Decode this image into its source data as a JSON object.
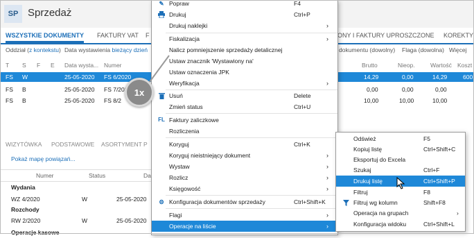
{
  "app": {
    "logo": "SP",
    "title": "Sprzedaż"
  },
  "tabs": [
    {
      "label": "WSZYSTKIE DOKUMENTY"
    },
    {
      "label": "FAKTURY VAT"
    },
    {
      "label": "F"
    },
    {
      "label": "ONY I FAKTURY UPROSZCZONE"
    },
    {
      "label": "KOREKTY"
    }
  ],
  "filters": {
    "branch_prefix": "Oddział (",
    "branch_link": "z kontekstu",
    "branch_suffix": ")",
    "date_prefix": "Data wystawienia",
    "date_link": "bieżący dzień",
    "doc_number": "dokumentu (dowolny)",
    "flag": "Flaga (dowolna)",
    "more": "Więcej"
  },
  "grid": {
    "headers": [
      "T",
      "S",
      "F",
      "E",
      "Data wysta...",
      "Numer",
      "Brutto",
      "Nieop.",
      "Wartość",
      "Koszt"
    ],
    "rows": [
      {
        "t": "FS",
        "s": "W",
        "date": "25-05-2020",
        "num": "FS 6/2020",
        "brutto": "14,29",
        "nieop": "0,00",
        "wartosc": "14,29",
        "koszt": "600",
        "selected": true
      },
      {
        "t": "FS",
        "s": "B",
        "date": "25-05-2020",
        "num": "FS 7/202",
        "brutto": "0,00",
        "nieop": "0,00",
        "wartosc": "0,00",
        "koszt": "",
        "selected": false
      },
      {
        "t": "FS",
        "s": "B",
        "date": "25-05-2020",
        "num": "FS 8/2",
        "brutto": "10,00",
        "nieop": "10,00",
        "wartosc": "10,00",
        "koszt": "",
        "selected": false
      }
    ]
  },
  "lower": {
    "tabs": [
      "WIZYTÓWKA",
      "PODSTAWOWE",
      "ASORTYMENT",
      "P"
    ],
    "show_map": "Pokaż mapę powiązań...",
    "headers": [
      "Numer",
      "Status",
      "Da"
    ],
    "groups": [
      {
        "name": "Wydania",
        "rows": [
          {
            "num": "WZ 4/2020",
            "status": "W",
            "date": "25-05-2020"
          }
        ]
      },
      {
        "name": "Rozchody",
        "rows": [
          {
            "num": "RW 2/2020",
            "status": "W",
            "date": "25-05-2020"
          }
        ]
      },
      {
        "name": "Operacje kasowe",
        "rows": []
      }
    ]
  },
  "menu": {
    "items": [
      {
        "label": "Popraw",
        "shortcut": "F4",
        "icon": "edit-icon"
      },
      {
        "label": "Drukuj",
        "shortcut": "Ctrl+P",
        "icon": "printer-icon"
      },
      {
        "label": "Drukuj naklejki",
        "submenu": true
      },
      {
        "label": "Fiskalizacja",
        "submenu": true
      },
      {
        "label": "Nalicz pomniejszenie sprzedaży detalicznej"
      },
      {
        "label": "Ustaw znacznik 'Wystawiony na'"
      },
      {
        "label": "Ustaw oznaczenia JPK"
      },
      {
        "label": "Weryfikacja",
        "submenu": true
      },
      {
        "label": "Usuń",
        "shortcut": "Delete",
        "icon": "trash-icon"
      },
      {
        "label": "Zmień status",
        "shortcut": "Ctrl+U"
      },
      {
        "label": "Faktury zaliczkowe",
        "icon": "advance-invoice-icon",
        "icon_text": "FL"
      },
      {
        "label": "Rozliczenia"
      },
      {
        "label": "Koryguj",
        "shortcut": "Ctrl+K"
      },
      {
        "label": "Koryguj nieistniejący dokument",
        "submenu": true
      },
      {
        "label": "Wystaw",
        "submenu": true
      },
      {
        "label": "Rozlicz",
        "submenu": true
      },
      {
        "label": "Księgowość",
        "submenu": true
      },
      {
        "label": "Konfiguracja dokumentów sprzedaży",
        "shortcut": "Ctrl+Shift+K",
        "icon": "gear-icon"
      },
      {
        "label": "Flagi",
        "submenu": true
      },
      {
        "label": "Operacje na liście",
        "submenu": true,
        "highlighted": true
      }
    ]
  },
  "submenu": {
    "items": [
      {
        "label": "Odśwież",
        "shortcut": "F5"
      },
      {
        "label": "Kopiuj listę",
        "shortcut": "Ctrl+Shift+C"
      },
      {
        "label": "Eksportuj do Excela"
      },
      {
        "label": "Szukaj",
        "shortcut": "Ctrl+F"
      },
      {
        "label": "Drukuj listę",
        "shortcut": "Ctrl+Shift+P",
        "highlighted": true
      },
      {
        "label": "Filtruj",
        "shortcut": "F8"
      },
      {
        "label": "Filtruj wg kolumn",
        "shortcut": "Shift+F8",
        "icon": "filter-icon"
      },
      {
        "label": "Operacja na grupach",
        "submenu": true
      },
      {
        "label": "Konfiguracja widoku",
        "shortcut": "Ctrl+Shift+L"
      }
    ]
  },
  "badge": {
    "text": "1x"
  },
  "colors": {
    "accent": "#1e88d8",
    "brand": "#1c6fb8"
  }
}
